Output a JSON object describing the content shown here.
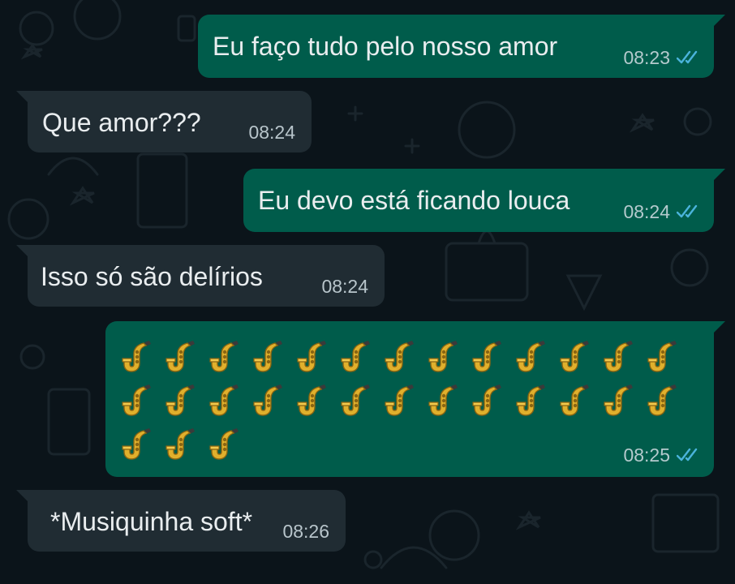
{
  "messages": [
    {
      "direction": "outgoing",
      "text": "Eu faço tudo pelo nosso amor",
      "time": "08:23",
      "status": "read"
    },
    {
      "direction": "incoming",
      "text": "Que amor???",
      "time": "08:24"
    },
    {
      "direction": "outgoing",
      "text": "Eu devo está ficando louca",
      "time": "08:24",
      "status": "read"
    },
    {
      "direction": "incoming",
      "text": "Isso só são delírios",
      "time": "08:24"
    },
    {
      "direction": "outgoing",
      "emoji": "saxophone",
      "emoji_count": 29,
      "time": "08:25",
      "status": "read"
    },
    {
      "direction": "incoming",
      "text": "*Musiquinha soft*",
      "time": "08:26"
    }
  ],
  "colors": {
    "background": "#0b141a",
    "outgoing_bubble": "#005c4b",
    "incoming_bubble": "#202c33",
    "read_ticks": "#53bdeb"
  }
}
